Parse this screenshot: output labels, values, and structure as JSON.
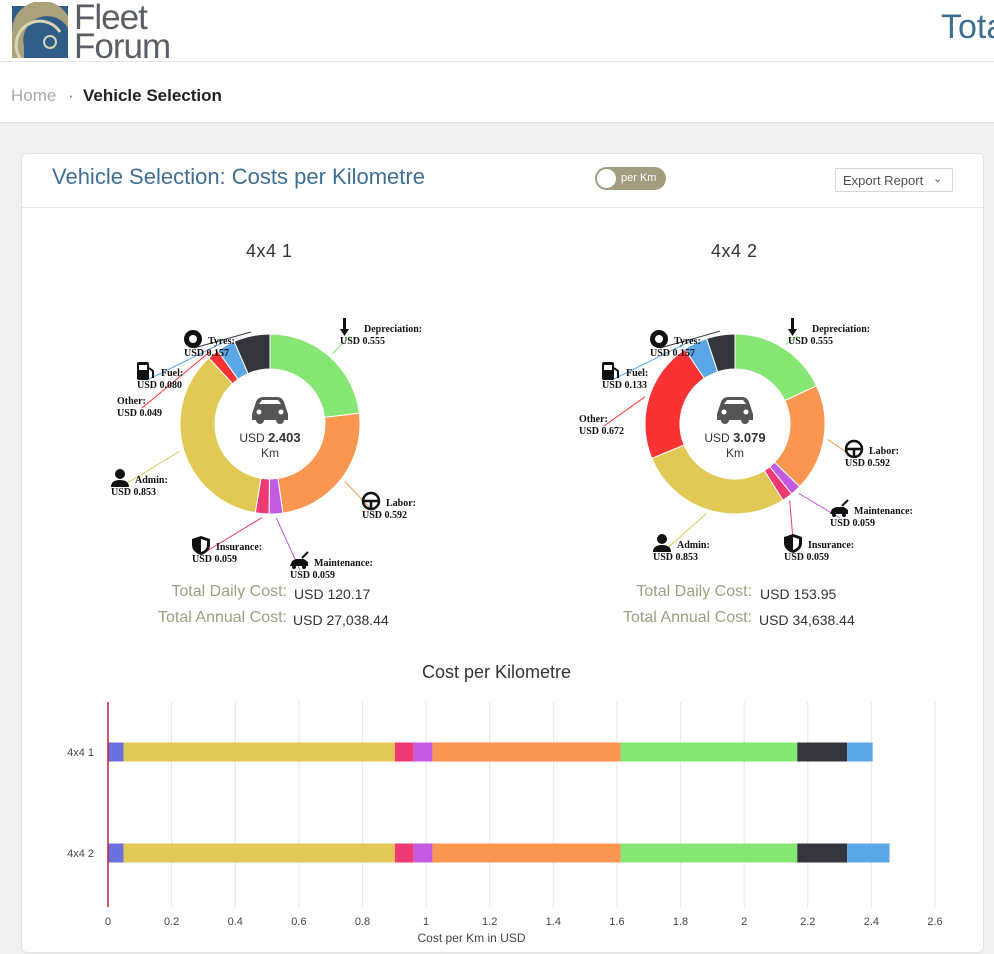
{
  "header": {
    "logo_line1": "Fleet",
    "logo_line2": "Forum",
    "page_title": "Tota"
  },
  "breadcrumb": {
    "home": "Home",
    "separator": "·",
    "current": "Vehicle Selection"
  },
  "card": {
    "title": "Vehicle Selection: Costs per Kilometre",
    "toggle_label": "per Km",
    "toggle_on": true,
    "export_label": "Export Report",
    "colors": {
      "title": "#3e6f93",
      "toggle": "#a29d80",
      "totals_label": "#a29d80"
    }
  },
  "vehicles": [
    {
      "name": "4x4 1",
      "center_prefix": "USD",
      "center_value": "2.403",
      "center_unit": "Km",
      "total_daily_label": "Total Daily Cost:",
      "total_daily_value": "USD  120.17",
      "total_annual_label": "Total Annual Cost:",
      "total_annual_value": "USD  27,038.44"
    },
    {
      "name": "4x4 2",
      "center_prefix": "USD",
      "center_value": "3.079",
      "center_unit": "Km",
      "total_daily_label": "Total Daily Cost:",
      "total_daily_value": "USD  153.95",
      "total_annual_label": "Total Annual Cost:",
      "total_annual_value": "USD  34,638.44"
    }
  ],
  "chart_data": [
    {
      "type": "pie",
      "title": "4x4 1",
      "hole": true,
      "slices": [
        {
          "name": "Depreciation:",
          "label": "USD 0.555",
          "value": 0.555,
          "color": "#86e673",
          "icon": "arrow-down-icon"
        },
        {
          "name": "Labor:",
          "label": "USD 0.592",
          "value": 0.592,
          "color": "#fb9651",
          "icon": "steering-wheel-icon"
        },
        {
          "name": "Maintenance:",
          "label": "USD 0.059",
          "value": 0.059,
          "color": "#c25be0",
          "icon": "car-repair-icon"
        },
        {
          "name": "Insurance:",
          "label": "USD 0.059",
          "value": 0.059,
          "color": "#ee3a72",
          "icon": "shield-icon"
        },
        {
          "name": "Admin:",
          "label": "USD 0.853",
          "value": 0.853,
          "color": "#e2c855",
          "icon": "admin-person-icon"
        },
        {
          "name": "Other:",
          "label": "USD 0.049",
          "value": 0.049,
          "color": "#fa3233",
          "icon": ""
        },
        {
          "name": "Fuel:",
          "label": "USD 0.080",
          "value": 0.08,
          "color": "#5aa6e6",
          "icon": "fuel-pump-icon"
        },
        {
          "name": "Tyres:",
          "label": "USD 0.157",
          "value": 0.157,
          "color": "#33363d",
          "icon": "tyre-icon"
        }
      ]
    },
    {
      "type": "pie",
      "title": "4x4 2",
      "hole": true,
      "slices": [
        {
          "name": "Depreciation:",
          "label": "USD 0.555",
          "value": 0.555,
          "color": "#86e673",
          "icon": "arrow-down-icon"
        },
        {
          "name": "Labor:",
          "label": "USD 0.592",
          "value": 0.592,
          "color": "#fb9651",
          "icon": "steering-wheel-icon"
        },
        {
          "name": "Maintenance:",
          "label": "USD 0.059",
          "value": 0.059,
          "color": "#c25be0",
          "icon": "car-repair-icon"
        },
        {
          "name": "Insurance:",
          "label": "USD 0.059",
          "value": 0.059,
          "color": "#ee3a72",
          "icon": "shield-icon"
        },
        {
          "name": "Admin:",
          "label": "USD 0.853",
          "value": 0.853,
          "color": "#e2c855",
          "icon": "admin-person-icon"
        },
        {
          "name": "Other:",
          "label": "USD 0.672",
          "value": 0.672,
          "color": "#fa3233",
          "icon": ""
        },
        {
          "name": "Fuel:",
          "label": "USD 0.133",
          "value": 0.133,
          "color": "#5aa6e6",
          "icon": "fuel-pump-icon"
        },
        {
          "name": "Tyres:",
          "label": "USD 0.157",
          "value": 0.157,
          "color": "#33363d",
          "icon": "tyre-icon"
        }
      ]
    },
    {
      "type": "bar",
      "orientation": "horizontal",
      "stacked": true,
      "title": "Cost per Kilometre",
      "xlabel": "Cost per Km in USD",
      "ylabel": "",
      "categories": [
        "4x4 1",
        "4x4 2"
      ],
      "xlim": [
        0,
        2.6
      ],
      "xticks": [
        0,
        0.2,
        0.4,
        0.6,
        0.8,
        1,
        1.2,
        1.4,
        1.6,
        1.8,
        2,
        2.2,
        2.4,
        2.6
      ],
      "xtick_labels": [
        "0",
        "0.2",
        "0.4",
        "0.6",
        "0.8",
        "1",
        "1.2",
        "1.4",
        "1.6",
        "1.8",
        "2",
        "2.2",
        "2.4",
        "2.6"
      ],
      "grid": true,
      "series": [
        {
          "color": "#6a71dd",
          "values": [
            0.049,
            0.049
          ]
        },
        {
          "color": "#e2c855",
          "values": [
            0.853,
            0.853
          ]
        },
        {
          "color": "#ee3a72",
          "values": [
            0.059,
            0.059
          ]
        },
        {
          "color": "#c25be0",
          "values": [
            0.059,
            0.059
          ]
        },
        {
          "color": "#fb9651",
          "values": [
            0.592,
            0.592
          ]
        },
        {
          "color": "#86e673",
          "values": [
            0.555,
            0.555
          ]
        },
        {
          "color": "#33363d",
          "values": [
            0.157,
            0.157
          ]
        },
        {
          "color": "#5aa6e6",
          "values": [
            0.08,
            0.133
          ]
        }
      ]
    }
  ]
}
